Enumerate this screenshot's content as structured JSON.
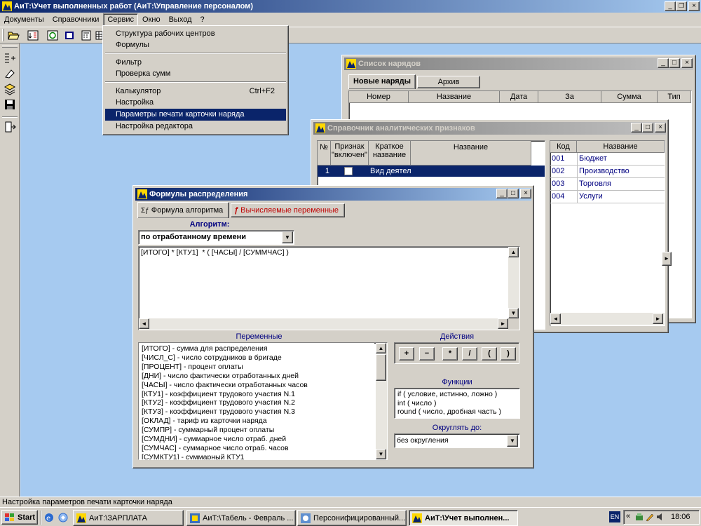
{
  "app": {
    "title": "АиТ:\\Учет выполненных работ  (АиТ:\\Управление персоналом)"
  },
  "menubar": [
    "Документы",
    "Справочники",
    "Сервис",
    "Окно",
    "Выход",
    "?"
  ],
  "service_menu": {
    "group1": [
      "Структура рабочих центров",
      "Формулы"
    ],
    "group2": [
      "Фильтр",
      "Проверка сумм"
    ],
    "group3": [
      {
        "label": "Калькулятор",
        "shortcut": "Ctrl+F2"
      },
      {
        "label": "Настройка",
        "shortcut": ""
      },
      {
        "label": "Параметры печати карточки наряда",
        "shortcut": ""
      },
      {
        "label": "Настройка редактора",
        "shortcut": ""
      }
    ],
    "highlighted": "Параметры печати карточки наряда"
  },
  "orders_window": {
    "title": "Список нарядов",
    "tabs": [
      "Новые наряды",
      "Архив"
    ],
    "columns": [
      "Номер",
      "Название",
      "Дата",
      "За",
      "Сумма",
      "Тип"
    ]
  },
  "analytics_window": {
    "title": "Справочник аналитических признаков",
    "left_columns": {
      "num": "№",
      "flag": "Признак \"включен\"",
      "short": "Краткое название",
      "name": "Название"
    },
    "left_row": {
      "num": "1",
      "short": "Вид деятел"
    },
    "right_columns": {
      "code": "Код",
      "name": "Название"
    },
    "right_rows": [
      {
        "code": "001",
        "name": "Бюджет"
      },
      {
        "code": "002",
        "name": "Производство"
      },
      {
        "code": "003",
        "name": "Торговля"
      },
      {
        "code": "004",
        "name": "Услуги"
      }
    ]
  },
  "formulas_window": {
    "title": "Формулы распределения",
    "tabs": [
      "Формула алгоритма",
      "Вычисляемые переменные"
    ],
    "algorithm_label": "Алгоритм:",
    "algorithm_value": "по отработанному времени",
    "formula": "[ИТОГО] * [КТУ1]  * ( [ЧАСЫ] / [СУММЧАС] )",
    "variables_label": "Переменные",
    "variables": [
      "[ИТОГО] - сумма для распределения",
      "[ЧИСЛ_С] - число сотрудников в бригаде",
      "[ПРОЦЕНТ] - процент оплаты",
      "[ДНИ] - число фактически отработанных дней",
      "[ЧАСЫ] - число фактически отработанных часов",
      "[КТУ1] - коэффициент  трудового участия N.1",
      "[КТУ2] - коэффициент  трудового участия N.2",
      "[КТУ3] - коэффициент  трудового участия N.3",
      "[ОКЛАД] - тариф из карточки наряда",
      "[СУМПР] - суммарный процент оплаты",
      "[СУМДНИ] - суммарное число отраб. дней",
      "[СУМЧАС] - суммарное число отраб. часов",
      "[СУМКТУ1] - суммарный КТУ1"
    ],
    "actions_label": "Действия",
    "actions": [
      "+",
      "−",
      "*",
      "/",
      "(",
      ")"
    ],
    "functions_label": "Функции",
    "functions": [
      "if ( условие, истинно, ложно )",
      "int ( число )",
      "round ( число, дробная часть )"
    ],
    "round_label": "Округлять до:",
    "round_value": "без округления"
  },
  "statusbar": {
    "text": "Настройка параметров печати карточки наряда"
  },
  "taskbar": {
    "start": "Start",
    "tasks": [
      "АиТ:\\ЗАРПЛАТА",
      "АиТ:\\Табель - Февраль ...",
      "Персонифицированный...",
      "АиТ:\\Учет выполнен..."
    ],
    "lang": "EN",
    "clock": "18:06"
  },
  "colors": {
    "desktop": "#a6caf0",
    "title_active": "#0a246a",
    "selection": "#0a246a",
    "chrome": "#d4d0c8",
    "link_text": "#000080"
  }
}
